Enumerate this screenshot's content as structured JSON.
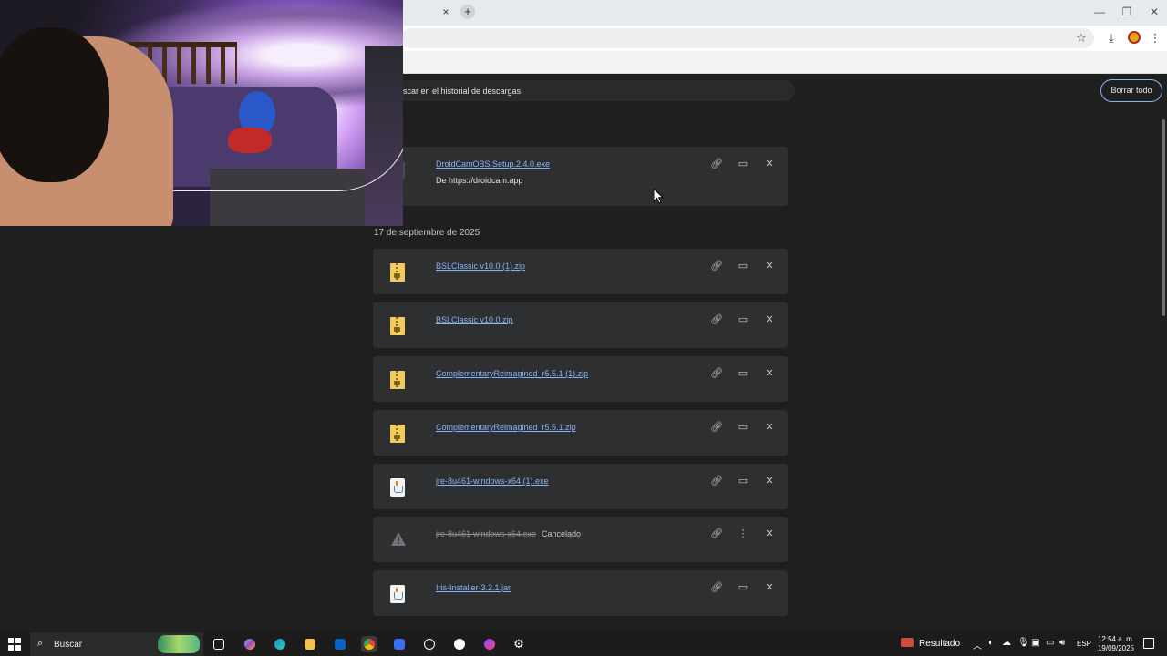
{
  "browser": {
    "tab_close_glyph": "×",
    "new_tab_glyph": "+",
    "window_controls": {
      "minimize": "—",
      "restore": "❐",
      "close": "✕"
    }
  },
  "downloads": {
    "search_placeholder": "scar en el historial de descargas",
    "clear_all_label": "Borrar todo",
    "section_date": "17 de septiembre de 2025",
    "items": [
      {
        "name": "DroidCamOBS.Setup.2.4.0.exe",
        "source": "De https://droidcam.app",
        "icon": "installer-icon",
        "state": "complete"
      },
      {
        "name": "BSLClassic v10.0 (1).zip",
        "icon": "zip-icon",
        "state": "complete"
      },
      {
        "name": "BSLClassic v10.0.zip",
        "icon": "zip-icon",
        "state": "complete"
      },
      {
        "name": "ComplementaryReimagined_r5.5.1 (1).zip",
        "icon": "zip-icon",
        "state": "complete"
      },
      {
        "name": "ComplementaryReimagined_r5.5.1.zip",
        "icon": "zip-icon",
        "state": "complete"
      },
      {
        "name": "jre-8u461-windows-x64 (1).exe",
        "icon": "java-icon",
        "state": "complete"
      },
      {
        "name": "jre-8u461-windows-x64.exe",
        "status": "Cancelado",
        "icon": "warning-icon",
        "state": "cancelled"
      },
      {
        "name": "Iris-Installer-3.2.1.jar",
        "icon": "java-icon",
        "state": "complete"
      }
    ]
  },
  "taskbar": {
    "search_label": "Buscar",
    "weather_label": "Resultado",
    "language": "ESP",
    "time": "12:54 a. m.",
    "date": "19/09/2025"
  },
  "colors": {
    "page_bg": "#1f1f1f",
    "card_bg": "#2d2f31",
    "link": "#8ab4f8",
    "accent_border": "#8ab4f8"
  }
}
